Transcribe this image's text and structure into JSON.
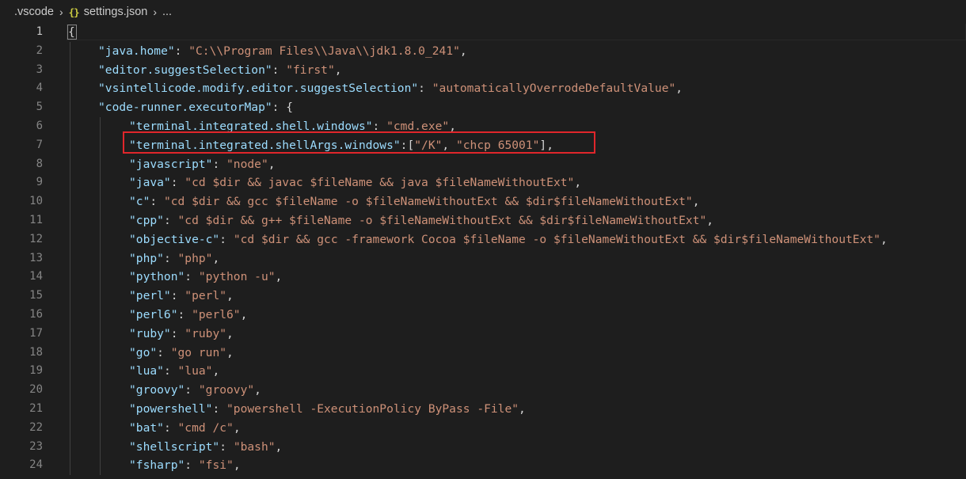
{
  "breadcrumb": {
    "folder": ".vscode",
    "file_icon": "json-braces-icon",
    "file": "settings.json",
    "more": "..."
  },
  "editor": {
    "active_line": 1,
    "highlighted_line": 7,
    "lines": [
      {
        "n": "1",
        "t": [
          [
            "p",
            "{"
          ]
        ]
      },
      {
        "n": "2",
        "t": [
          [
            "k",
            "\"java.home\""
          ],
          [
            "p",
            ": "
          ],
          [
            "s",
            "\"C:\\\\Program Files\\\\Java\\\\jdk1.8.0_241\""
          ],
          [
            "p",
            ","
          ]
        ]
      },
      {
        "n": "3",
        "t": [
          [
            "k",
            "\"editor.suggestSelection\""
          ],
          [
            "p",
            ": "
          ],
          [
            "s",
            "\"first\""
          ],
          [
            "p",
            ","
          ]
        ]
      },
      {
        "n": "4",
        "t": [
          [
            "k",
            "\"vsintellicode.modify.editor.suggestSelection\""
          ],
          [
            "p",
            ": "
          ],
          [
            "s",
            "\"automaticallyOverrodeDefaultValue\""
          ],
          [
            "p",
            ","
          ]
        ]
      },
      {
        "n": "5",
        "t": [
          [
            "k",
            "\"code-runner.executorMap\""
          ],
          [
            "p",
            ": {"
          ]
        ]
      },
      {
        "n": "6",
        "t": [
          [
            "k",
            "\"terminal.integrated.shell.windows\""
          ],
          [
            "p",
            ": "
          ],
          [
            "s",
            "\"cmd.exe\""
          ],
          [
            "p",
            ","
          ]
        ]
      },
      {
        "n": "7",
        "t": [
          [
            "k",
            "\"terminal.integrated.shellArgs.windows\""
          ],
          [
            "p",
            ":["
          ],
          [
            "s",
            "\"/K\""
          ],
          [
            "p",
            ", "
          ],
          [
            "s",
            "\"chcp 65001\""
          ],
          [
            "p",
            "],"
          ]
        ]
      },
      {
        "n": "8",
        "t": [
          [
            "k",
            "\"javascript\""
          ],
          [
            "p",
            ": "
          ],
          [
            "s",
            "\"node\""
          ],
          [
            "p",
            ","
          ]
        ]
      },
      {
        "n": "9",
        "t": [
          [
            "k",
            "\"java\""
          ],
          [
            "p",
            ": "
          ],
          [
            "s",
            "\"cd $dir && javac $fileName && java $fileNameWithoutExt\""
          ],
          [
            "p",
            ","
          ]
        ]
      },
      {
        "n": "10",
        "t": [
          [
            "k",
            "\"c\""
          ],
          [
            "p",
            ": "
          ],
          [
            "s",
            "\"cd $dir && gcc $fileName -o $fileNameWithoutExt && $dir$fileNameWithoutExt\""
          ],
          [
            "p",
            ","
          ]
        ]
      },
      {
        "n": "11",
        "t": [
          [
            "k",
            "\"cpp\""
          ],
          [
            "p",
            ": "
          ],
          [
            "s",
            "\"cd $dir && g++ $fileName -o $fileNameWithoutExt && $dir$fileNameWithoutExt\""
          ],
          [
            "p",
            ","
          ]
        ]
      },
      {
        "n": "12",
        "t": [
          [
            "k",
            "\"objective-c\""
          ],
          [
            "p",
            ": "
          ],
          [
            "s",
            "\"cd $dir && gcc -framework Cocoa $fileName -o $fileNameWithoutExt && $dir$fileNameWithoutExt\""
          ],
          [
            "p",
            ","
          ]
        ]
      },
      {
        "n": "13",
        "t": [
          [
            "k",
            "\"php\""
          ],
          [
            "p",
            ": "
          ],
          [
            "s",
            "\"php\""
          ],
          [
            "p",
            ","
          ]
        ]
      },
      {
        "n": "14",
        "t": [
          [
            "k",
            "\"python\""
          ],
          [
            "p",
            ": "
          ],
          [
            "s",
            "\"python -u\""
          ],
          [
            "p",
            ","
          ]
        ]
      },
      {
        "n": "15",
        "t": [
          [
            "k",
            "\"perl\""
          ],
          [
            "p",
            ": "
          ],
          [
            "s",
            "\"perl\""
          ],
          [
            "p",
            ","
          ]
        ]
      },
      {
        "n": "16",
        "t": [
          [
            "k",
            "\"perl6\""
          ],
          [
            "p",
            ": "
          ],
          [
            "s",
            "\"perl6\""
          ],
          [
            "p",
            ","
          ]
        ]
      },
      {
        "n": "17",
        "t": [
          [
            "k",
            "\"ruby\""
          ],
          [
            "p",
            ": "
          ],
          [
            "s",
            "\"ruby\""
          ],
          [
            "p",
            ","
          ]
        ]
      },
      {
        "n": "18",
        "t": [
          [
            "k",
            "\"go\""
          ],
          [
            "p",
            ": "
          ],
          [
            "s",
            "\"go run\""
          ],
          [
            "p",
            ","
          ]
        ]
      },
      {
        "n": "19",
        "t": [
          [
            "k",
            "\"lua\""
          ],
          [
            "p",
            ": "
          ],
          [
            "s",
            "\"lua\""
          ],
          [
            "p",
            ","
          ]
        ]
      },
      {
        "n": "20",
        "t": [
          [
            "k",
            "\"groovy\""
          ],
          [
            "p",
            ": "
          ],
          [
            "s",
            "\"groovy\""
          ],
          [
            "p",
            ","
          ]
        ]
      },
      {
        "n": "21",
        "t": [
          [
            "k",
            "\"powershell\""
          ],
          [
            "p",
            ": "
          ],
          [
            "s",
            "\"powershell -ExecutionPolicy ByPass -File\""
          ],
          [
            "p",
            ","
          ]
        ]
      },
      {
        "n": "22",
        "t": [
          [
            "k",
            "\"bat\""
          ],
          [
            "p",
            ": "
          ],
          [
            "s",
            "\"cmd /c\""
          ],
          [
            "p",
            ","
          ]
        ]
      },
      {
        "n": "23",
        "t": [
          [
            "k",
            "\"shellscript\""
          ],
          [
            "p",
            ": "
          ],
          [
            "s",
            "\"bash\""
          ],
          [
            "p",
            ","
          ]
        ]
      },
      {
        "n": "24",
        "t": [
          [
            "k",
            "\"fsharp\""
          ],
          [
            "p",
            ": "
          ],
          [
            "s",
            "\"fsi\""
          ],
          [
            "p",
            ","
          ]
        ]
      }
    ]
  },
  "colors": {
    "background": "#1e1e1e",
    "json_key": "#9cdcfe",
    "json_string": "#ce9178",
    "punctuation": "#d4d4d4",
    "line_number": "#858585",
    "json_icon": "#cbcb41",
    "annotation_box": "#e0262b"
  }
}
